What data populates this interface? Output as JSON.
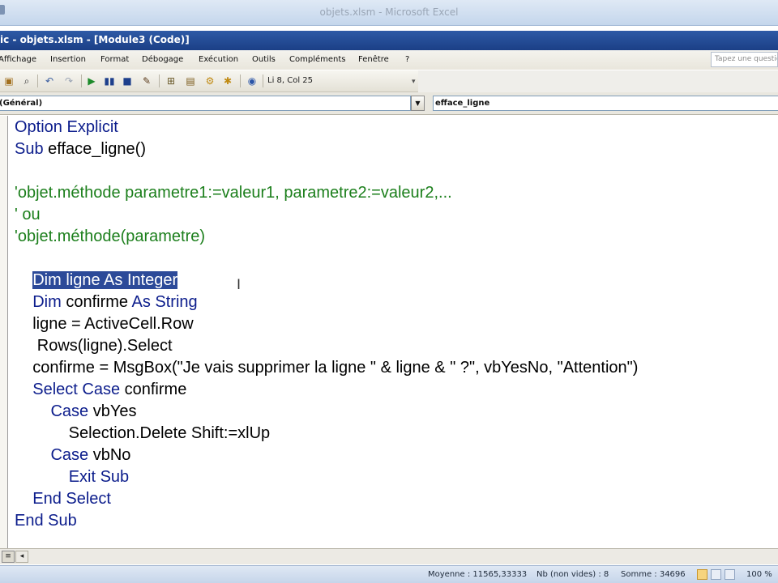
{
  "excel_window": {
    "title": "objets.xlsm - Microsoft Excel"
  },
  "vbe_window": {
    "title": "ic - objets.xlsm - [Module3 (Code)]"
  },
  "menu": {
    "items": [
      "Affichage",
      "Insertion",
      "Format",
      "Débogage",
      "Exécution",
      "Outils",
      "Compléments",
      "Fenêtre",
      "?"
    ],
    "help_placeholder": "Tapez une question"
  },
  "toolbar": {
    "cursor_position": "Li 8, Col 25",
    "icons": [
      "paste-icon",
      "find-icon",
      "undo-icon",
      "redo-icon",
      "run-icon",
      "break-icon",
      "reset-icon",
      "design-mode-icon",
      "project-explorer-icon",
      "properties-icon",
      "object-browser-icon",
      "toolbox-icon",
      "help-icon"
    ]
  },
  "code_header": {
    "object_combo": "(Général)",
    "procedure_combo": "efface_ligne"
  },
  "code": [
    [
      {
        "t": "Option Explicit",
        "c": "kw"
      }
    ],
    [
      {
        "t": "Sub ",
        "c": "kw"
      },
      {
        "t": "efface_ligne()",
        "c": ""
      }
    ],
    [],
    [
      {
        "t": "'objet.méthode parametre1:=valeur1, parametre2:=valeur2,...",
        "c": "cm"
      }
    ],
    [
      {
        "t": "' ou",
        "c": "cm"
      }
    ],
    [
      {
        "t": "'objet.méthode(parametre)",
        "c": "cm"
      }
    ],
    [],
    [
      {
        "t": "    ",
        "c": ""
      },
      {
        "t": "Dim ligne As Integer",
        "c": "sel"
      }
    ],
    [
      {
        "t": "    ",
        "c": ""
      },
      {
        "t": "Dim ",
        "c": "kw"
      },
      {
        "t": "confirme ",
        "c": ""
      },
      {
        "t": "As String",
        "c": "kw"
      }
    ],
    [
      {
        "t": "    ligne = ActiveCell.Row",
        "c": ""
      }
    ],
    [
      {
        "t": "     Rows(ligne).Select",
        "c": ""
      }
    ],
    [
      {
        "t": "    confirme = MsgBox(\"Je vais supprimer la ligne \" & ligne & \" ?\", vbYesNo, \"Attention\")",
        "c": ""
      }
    ],
    [
      {
        "t": "    ",
        "c": ""
      },
      {
        "t": "Select Case ",
        "c": "kw"
      },
      {
        "t": "confirme",
        "c": ""
      }
    ],
    [
      {
        "t": "        ",
        "c": ""
      },
      {
        "t": "Case ",
        "c": "kw"
      },
      {
        "t": "vbYes",
        "c": ""
      }
    ],
    [
      {
        "t": "            Selection.Delete Shift:=xlUp",
        "c": ""
      }
    ],
    [
      {
        "t": "        ",
        "c": ""
      },
      {
        "t": "Case ",
        "c": "kw"
      },
      {
        "t": "vbNo",
        "c": ""
      }
    ],
    [
      {
        "t": "            ",
        "c": ""
      },
      {
        "t": "Exit Sub",
        "c": "kw"
      }
    ],
    [
      {
        "t": "    ",
        "c": ""
      },
      {
        "t": "End Select",
        "c": "kw"
      }
    ],
    [
      {
        "t": "End Sub",
        "c": "kw"
      }
    ]
  ],
  "status": {
    "average": "Moyenne : 11565,33333",
    "count": "Nb (non vides) : 8",
    "sum": "Somme : 34696",
    "zoom": "100 %"
  }
}
